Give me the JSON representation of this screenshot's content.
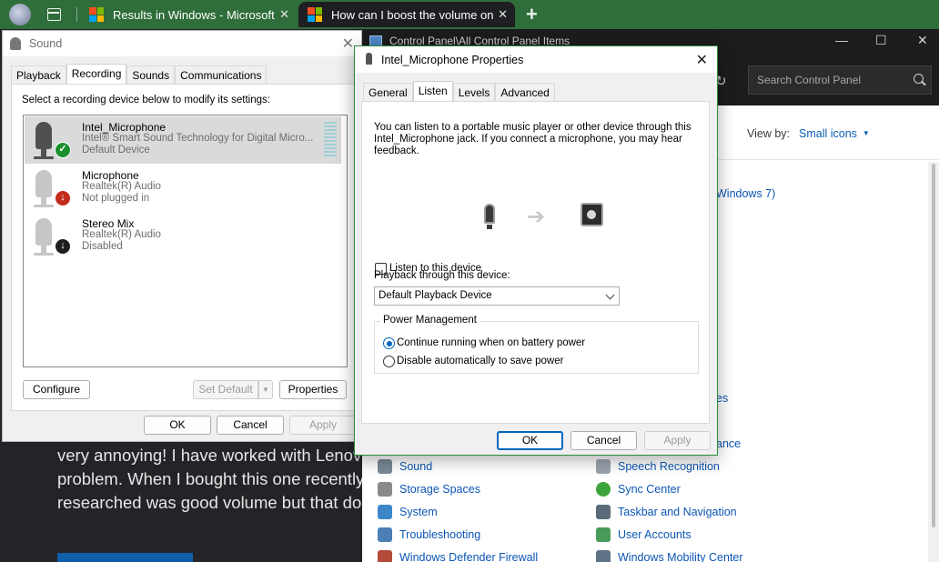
{
  "browser": {
    "tabs": [
      {
        "title": "Results in Windows - Microsoft C",
        "active": false
      },
      {
        "title": "How can I boost the volume on my",
        "active": true
      }
    ],
    "new_tab": "+"
  },
  "webpage": {
    "lines": [
      "very annoying! I have worked with Lenov",
      "problem. When I bought this one recently",
      "researched was good volume but that do"
    ]
  },
  "control_panel": {
    "title": "Control Panel\\All Control Panel Items",
    "search_placeholder": "Search Control Panel",
    "view_by_label": "View by:",
    "view_by_value": "Small icons",
    "fragments": {
      "windows7": "Windows 7)",
      "es": "es",
      "ance": "ance"
    },
    "items_left": [
      "Sound",
      "Storage Spaces",
      "System",
      "Troubleshooting",
      "Windows Defender Firewall"
    ],
    "items_right": [
      "Speech Recognition",
      "Sync Center",
      "Taskbar and Navigation",
      "User Accounts",
      "Windows Mobility Center"
    ]
  },
  "sound_dialog": {
    "title": "Sound",
    "tabs": [
      "Playback",
      "Recording",
      "Sounds",
      "Communications"
    ],
    "active_tab": "Recording",
    "instruction": "Select a recording device below to modify its settings:",
    "devices": [
      {
        "name": "Intel_Microphone",
        "driver": "Intel® Smart Sound Technology for Digital Micro...",
        "status": "Default Device",
        "badge": "check",
        "selected": true
      },
      {
        "name": "Microphone",
        "driver": "Realtek(R) Audio",
        "status": "Not plugged in",
        "badge": "down-red",
        "selected": false
      },
      {
        "name": "Stereo Mix",
        "driver": "Realtek(R) Audio",
        "status": "Disabled",
        "badge": "down-black",
        "selected": false
      }
    ],
    "buttons": {
      "configure": "Configure",
      "set_default": "Set Default",
      "properties": "Properties",
      "ok": "OK",
      "cancel": "Cancel",
      "apply": "Apply"
    }
  },
  "props_dialog": {
    "title": "Intel_Microphone Properties",
    "tabs": [
      "General",
      "Listen",
      "Levels",
      "Advanced"
    ],
    "active_tab": "Listen",
    "description": "You can listen to a portable music player or other device through this Intel_Microphone jack.  If you connect a microphone, you may hear feedback.",
    "listen_checkbox": "Listen to this device",
    "listen_checked": false,
    "playback_label": "Playback through this device:",
    "playback_value": "Default Playback Device",
    "power_group": "Power Management",
    "power_options": [
      "Continue running when on battery power",
      "Disable automatically to save power"
    ],
    "power_selected": 0,
    "buttons": {
      "ok": "OK",
      "cancel": "Cancel",
      "apply": "Apply"
    }
  },
  "colors": {
    "accent": "#0067c0",
    "tabbar": "#2f6d3a",
    "link": "#0b56b4",
    "check_green": "#1a8f2c",
    "not_plugged_red": "#c42b1c"
  }
}
